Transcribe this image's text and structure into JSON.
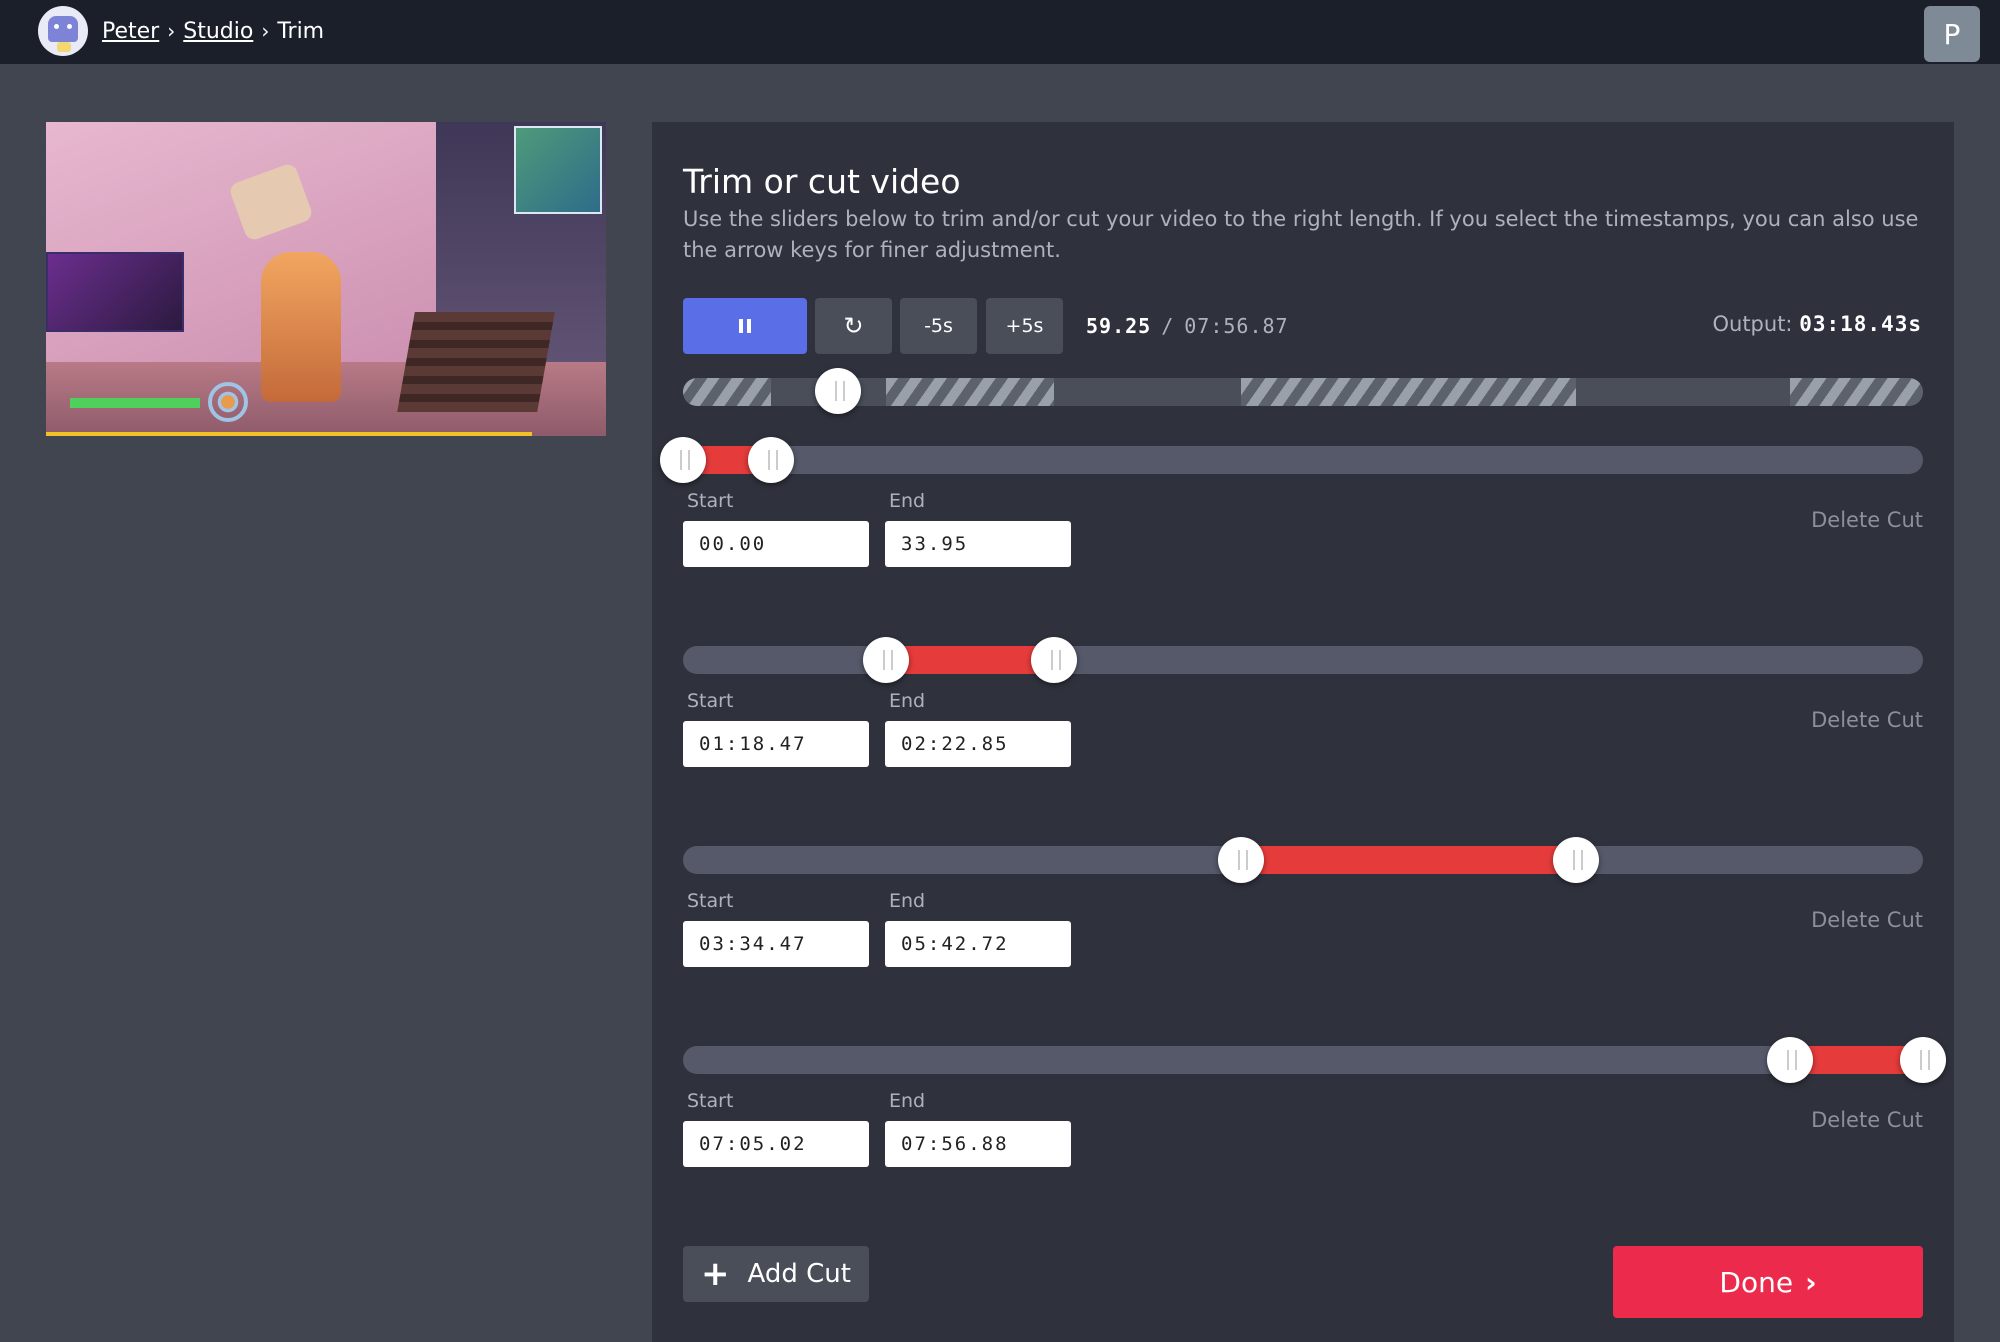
{
  "breadcrumb": {
    "home": "Peter",
    "studio": "Studio",
    "current": "Trim",
    "sep": "›"
  },
  "user": {
    "initial": "P"
  },
  "panel": {
    "title": "Trim or cut video",
    "description": "Use the sliders below to trim and/or cut your video to the right length. If you select the timestamps, you can also use the arrow keys for finer adjustment."
  },
  "controls": {
    "minus_label": "-5s",
    "plus_label": "+5s",
    "reset_glyph": "↻",
    "current_time": "59.25",
    "separator": "/",
    "total_time": "07:56.87",
    "output_label": "Output:",
    "output_value": "03:18.43s"
  },
  "labels": {
    "start": "Start",
    "end": "End",
    "delete": "Delete Cut"
  },
  "cuts": [
    {
      "start": "00.00",
      "end": "33.95"
    },
    {
      "start": "01:18.47",
      "end": "02:22.85"
    },
    {
      "start": "03:34.47",
      "end": "05:42.72"
    },
    {
      "start": "07:05.02",
      "end": "07:56.88"
    }
  ],
  "actions": {
    "add_cut": "Add Cut",
    "add_glyph": "+",
    "done": "Done",
    "done_glyph": "›"
  },
  "colors": {
    "accent": "#5a6ee8",
    "cut_fill": "#e53b3b",
    "done": "#eb2a4c",
    "topbar": "#1b1f2a"
  }
}
